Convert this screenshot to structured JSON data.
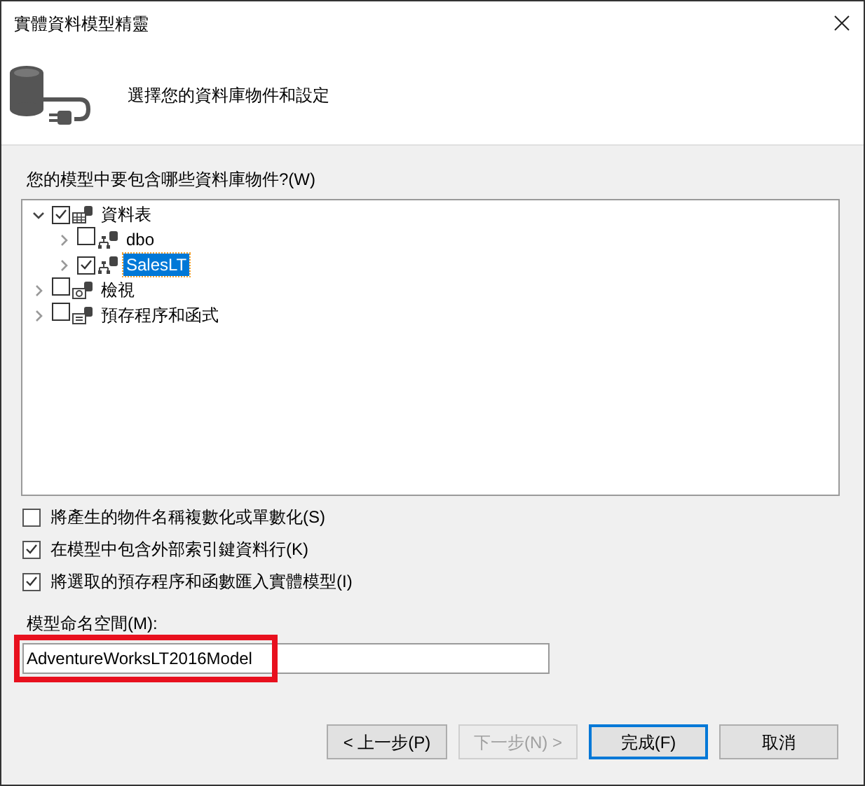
{
  "window": {
    "title": "實體資料模型精靈"
  },
  "header": {
    "heading": "選擇您的資料庫物件和設定"
  },
  "tree": {
    "label": "您的模型中要包含哪些資料庫物件?(W)",
    "items": [
      {
        "label": "資料表",
        "kind": "tables",
        "checked": true,
        "expanded": true,
        "selected": false,
        "children": [
          {
            "label": "dbo",
            "kind": "schema",
            "checked": false,
            "expanded": false,
            "selected": false
          },
          {
            "label": "SalesLT",
            "kind": "schema",
            "checked": true,
            "expanded": false,
            "selected": true
          }
        ]
      },
      {
        "label": "檢視",
        "kind": "views",
        "checked": false,
        "expanded": false,
        "selected": false
      },
      {
        "label": "預存程序和函式",
        "kind": "procedures",
        "checked": false,
        "expanded": false,
        "selected": false
      }
    ]
  },
  "options": [
    {
      "label": "將產生的物件名稱複數化或單數化(S)",
      "checked": false
    },
    {
      "label": "在模型中包含外部索引鍵資料行(K)",
      "checked": true
    },
    {
      "label": "將選取的預存程序和函數匯入實體模型(I)",
      "checked": true
    }
  ],
  "namespace": {
    "label": "模型命名空間(M):",
    "value": "AdventureWorksLT2016Model",
    "highlighted": true
  },
  "buttons": [
    {
      "label": "< 上一步(P)",
      "disabled": false,
      "default": false
    },
    {
      "label": "下一步(N) >",
      "disabled": true,
      "default": false
    },
    {
      "label": "完成(F)",
      "disabled": false,
      "default": true
    },
    {
      "label": "取消",
      "disabled": false,
      "default": false
    }
  ]
}
